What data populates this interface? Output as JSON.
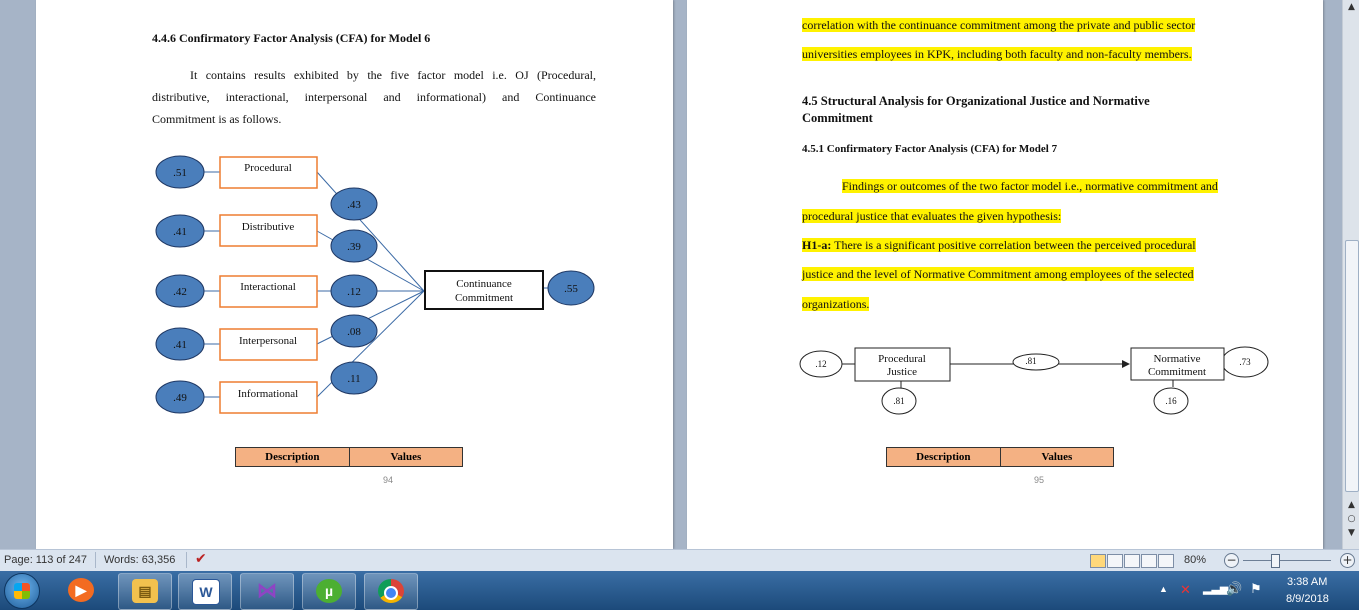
{
  "page_left": {
    "heading": "4.4.6 Confirmatory Factor Analysis (CFA) for Model 6",
    "para_l1": "It contains results exhibited by the five factor model i.e. OJ (Procedural,",
    "para_l2": "distributive, interactional, interpersonal and informational) and Continuance",
    "para_l3": "Commitment is as follows.",
    "diagram": {
      "errors": [
        ".51",
        ".41",
        ".42",
        ".41",
        ".49"
      ],
      "factors": [
        "Procedural",
        "Distributive",
        "Interactional",
        "Interpersonal",
        "Informational"
      ],
      "loadings": [
        ".43",
        ".39",
        ".12",
        ".08",
        ".11"
      ],
      "outcome_l1": "Continuance",
      "outcome_l2": "Commitment",
      "outcome_error": ".55"
    },
    "table_headers": [
      "Description",
      "Values"
    ],
    "page_number": "94"
  },
  "page_right": {
    "line1": "correlation with the continuance commitment among the private and public sector",
    "line2": "universities employees in KPK, including both faculty and non-faculty members.",
    "section_l1": "4.5 Structural Analysis for Organizational Justice and Normative",
    "section_l2": "Commitment",
    "subheading": "4.5.1 Confirmatory Factor Analysis (CFA) for Model 7",
    "find_l1": "Findings or outcomes of the two factor model i.e., normative commitment and",
    "find_l2": "procedural justice that evaluates the given hypothesis:",
    "hyp_label": "H1-a:",
    "hyp_l1": " There is a significant positive correlation between the perceived procedural",
    "hyp_l2": "justice and the level of Normative Commitment among employees of the selected",
    "hyp_l3": "organizations.",
    "diagram": {
      "left_error": ".12",
      "box1_l1": "Procedural",
      "box1_l2": "Justice",
      "path": ".81",
      "box2_l1": "Normative",
      "box2_l2": "Commitment",
      "right_error": ".73",
      "under1": ".81",
      "under2": ".16"
    },
    "table_headers": [
      "Description",
      "Values"
    ],
    "page_number": "95"
  },
  "status_bar": {
    "page": "Page: 113 of 247",
    "words": "Words: 63,356",
    "zoom": "80%"
  },
  "tray": {
    "time": "3:38 AM",
    "date": "8/9/2018"
  },
  "colors": {
    "oval_fill": "#4a7ebb",
    "box_border": "#ed7d31",
    "table_fill": "#f4b183",
    "highlight": "#fff200"
  }
}
